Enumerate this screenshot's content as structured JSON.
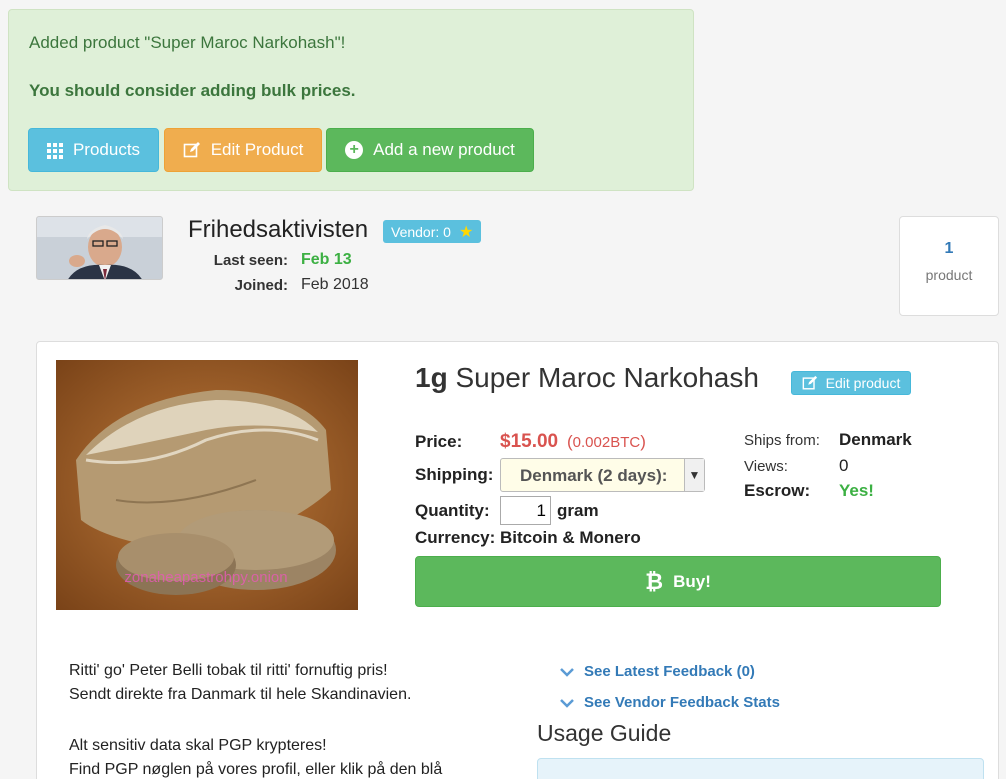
{
  "alert": {
    "message": "Added product \"Super Maroc Narkohash\"!",
    "bulk_hint": "You should consider adding bulk prices.",
    "products_label": "Products",
    "edit_label": "Edit Product",
    "add_label": "Add a new product"
  },
  "vendor": {
    "name": "Frihedsaktivisten",
    "badge": "Vendor: 0",
    "last_seen_label": "Last seen:",
    "last_seen": "Feb 13",
    "joined_label": "Joined:",
    "joined": "Feb 2018",
    "product_count": "1",
    "product_unit": "product"
  },
  "product": {
    "qty_prefix": "1g",
    "name": "Super Maroc Narkohash",
    "edit_label": "Edit product",
    "image_watermark": "zonaheapastrohpy.onion",
    "price_label": "Price:",
    "price": "$15.00",
    "btc_open": "(",
    "btc_amount": "0.002BTC",
    "btc_close": ")",
    "shipping_label": "Shipping:",
    "shipping_option": "Denmark (2 days):",
    "quantity_label": "Quantity:",
    "quantity_value": "1",
    "quantity_unit": "gram",
    "currency_label": "Currency:",
    "currency": "Bitcoin & Monero",
    "ships_from_label": "Ships from:",
    "ships_from": "Denmark",
    "views_label": "Views:",
    "views": "0",
    "escrow_label": "Escrow:",
    "escrow": "Yes!",
    "buy_label": "Buy!"
  },
  "description": {
    "line1": "Ritti' go' Peter Belli tobak til ritti' fornuftig pris!",
    "line2": "Sendt direkte fra Danmark til hele Skandinavien.",
    "line3": "Alt sensitiv data skal PGP krypteres!",
    "line4": "Find PGP nøglen på vores profil, eller klik på den blå"
  },
  "feedback": {
    "latest_label": "See Latest Feedback (0)",
    "stats_label": "See Vendor Feedback Stats",
    "usage_title": "Usage Guide"
  },
  "colors": {
    "success_bg": "#dff0d8",
    "info": "#5bc0de",
    "warning": "#f0ad4e",
    "success": "#5cb85c",
    "danger": "#d9534f",
    "link": "#337ab7"
  }
}
